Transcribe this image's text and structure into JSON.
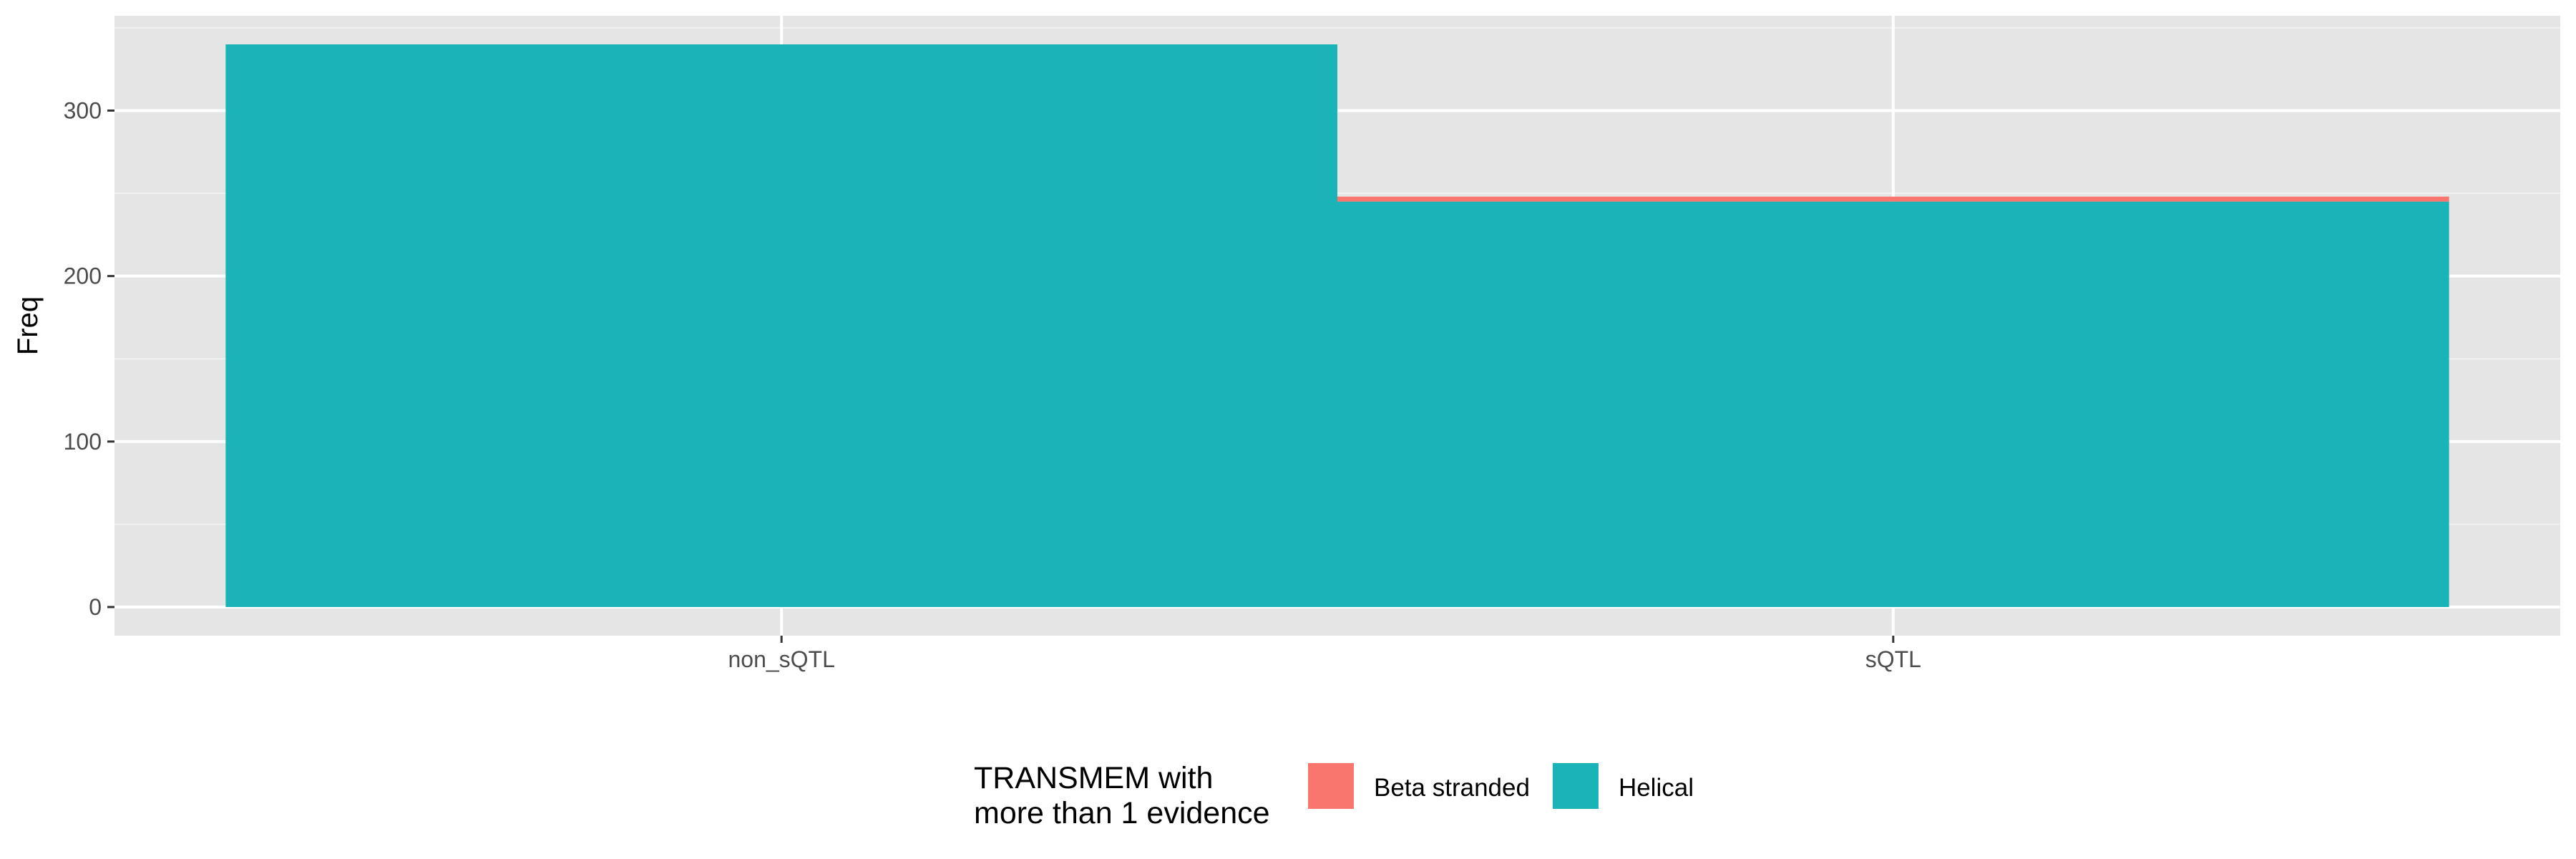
{
  "chart_data": {
    "type": "bar",
    "stacked": true,
    "categories": [
      "non_sQTL",
      "sQTL"
    ],
    "series": [
      {
        "name": "Beta stranded",
        "values": [
          0,
          3
        ],
        "color": "#F8766D"
      },
      {
        "name": "Helical",
        "values": [
          340,
          245
        ],
        "color": "#19B3B8"
      }
    ],
    "xlabel": "",
    "ylabel": "Freq",
    "ylim": [
      0,
      340
    ],
    "yticks": [
      0,
      100,
      200,
      300
    ],
    "grid": true,
    "background": "#E5E5E5",
    "legend": {
      "position": "bottom",
      "title_lines": [
        "TRANSMEM with",
        "more than 1 evidence"
      ]
    }
  }
}
